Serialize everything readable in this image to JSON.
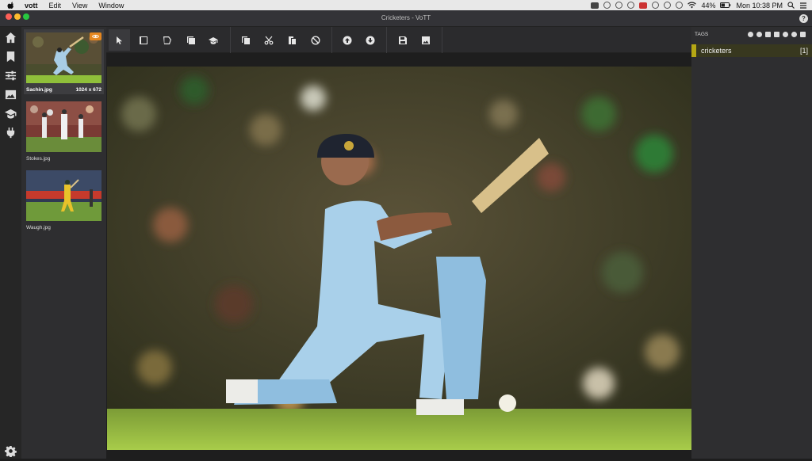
{
  "menubar": {
    "app_name": "vott",
    "menus": [
      "Edit",
      "View",
      "Window"
    ],
    "battery": "44%",
    "clock": "Mon 10:38 PM"
  },
  "window": {
    "title": "Cricketers - VoTT"
  },
  "leftnav": {
    "items": [
      "home-icon",
      "bookmark-icon",
      "sliders-icon",
      "image-icon",
      "graduation-cap-icon",
      "plug-icon"
    ],
    "settings": "gear-icon"
  },
  "thumbnails": [
    {
      "name": "Sachin.jpg",
      "size": "1024 x 672",
      "active": true,
      "visited": true
    },
    {
      "name": "Stokes.jpg",
      "size": "",
      "active": false,
      "visited": false
    },
    {
      "name": "Waugh.jpg",
      "size": "",
      "active": false,
      "visited": false
    }
  ],
  "toolbar": {
    "tools": [
      "pointer-icon",
      "rectangle-icon",
      "polygon-icon",
      "copy-rectangle-icon",
      "active-learning-icon",
      "copy-icon",
      "cut-icon",
      "paste-icon",
      "clear-icon",
      "previous-asset-icon",
      "next-asset-icon",
      "save-icon",
      "export-icon"
    ]
  },
  "tags": {
    "header": "TAGS",
    "items": [
      {
        "name": "cricketers",
        "hotkey": "[1]",
        "color": "#b6a814"
      }
    ]
  },
  "colors": {
    "accent": "#e6871f",
    "tag": "#b6a814",
    "panel": "#2e2e30"
  }
}
